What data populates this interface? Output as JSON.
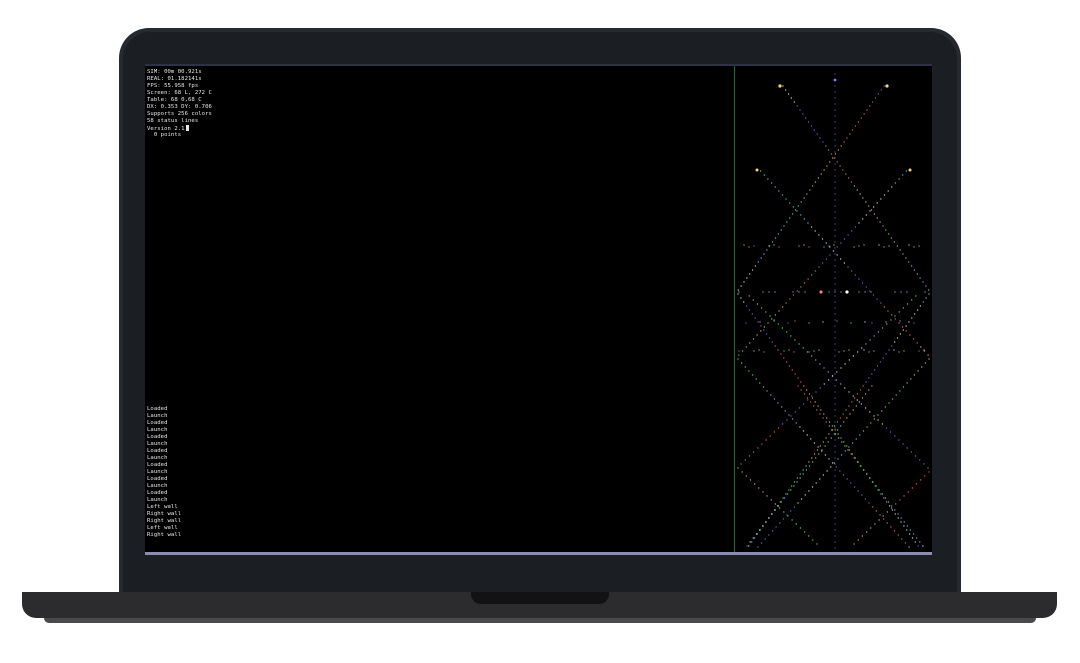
{
  "status_lines": [
    "SIM: 00m 00.921s",
    "REAL: 01.182141s",
    "FPS: 55.958 fps",
    "Screen: 68 L, 272 C",
    "Table: 68 0,68 C",
    "DX: 0.353 DY: 0.706",
    "Supports 256 colors",
    "58 status lines",
    "Version 2.1",
    "  0 points"
  ],
  "log_lines": [
    "Loaded",
    "Launch",
    "Loaded",
    "Launch",
    "Loaded",
    "Launch",
    "Loaded",
    "Launch",
    "Loaded",
    "Launch",
    "Loaded",
    "Launch",
    "Loaded",
    "Launch",
    "Left wall",
    "Right wall",
    "Right wall",
    "Left wall",
    "Right wall"
  ],
  "colors": {
    "screen_bg": "#000000",
    "text": "#e6e6e6",
    "divider": "#2f5f3a",
    "bottom_bar": "#8a8fb0",
    "dot_colors": [
      "#ffffff",
      "#7f7fff",
      "#ff7f7f",
      "#ffd27f",
      "#7fff7f",
      "#7fdfff"
    ]
  }
}
